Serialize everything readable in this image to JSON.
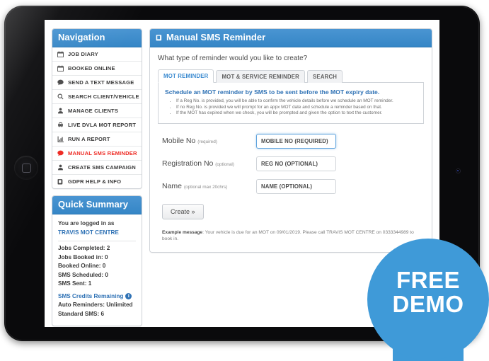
{
  "sidebar": {
    "nav_title": "Navigation",
    "nav_items": [
      {
        "label": "JOB DIARY",
        "icon": "calendar-icon",
        "active": false
      },
      {
        "label": "BOOKED ONLINE",
        "icon": "calendar-icon",
        "active": false
      },
      {
        "label": "SEND A TEXT MESSAGE",
        "icon": "comment-icon",
        "active": false
      },
      {
        "label": "SEARCH CLIENT/VEHICLE",
        "icon": "search-icon",
        "active": false
      },
      {
        "label": "MANAGE CLIENTS",
        "icon": "user-icon",
        "active": false
      },
      {
        "label": "LIVE DVLA MOT REPORT",
        "icon": "car-icon",
        "active": false
      },
      {
        "label": "RUN A REPORT",
        "icon": "chart-icon",
        "active": false
      },
      {
        "label": "MANUAL SMS REMINDER",
        "icon": "comment-icon",
        "active": true
      },
      {
        "label": "CREATE SMS CAMPAIGN",
        "icon": "user-icon",
        "active": false
      },
      {
        "label": "GDPR HELP & INFO",
        "icon": "book-icon",
        "active": false
      }
    ],
    "summary_title": "Quick Summary",
    "summary": {
      "logged_in_label": "You are logged in as",
      "company": "TRAVIS MOT CENTRE",
      "stats": [
        "Jobs Completed: 2",
        "Jobs Booked in: 0",
        "Booked Online: 0",
        "SMS Scheduled: 0",
        "SMS Sent: 1"
      ],
      "credits_label": "SMS Credits Remaining",
      "credits_info_glyph": "i",
      "auto_reminders": "Auto Reminders: Unlimited",
      "standard_sms": "Standard SMS: 6"
    }
  },
  "main": {
    "title": "Manual SMS Reminder",
    "title_icon": "book-icon",
    "question": "What type of reminder would you like to create?",
    "tabs": [
      {
        "label": "MOT REMINDER",
        "active": true
      },
      {
        "label": "MOT & SERVICE REMINDER",
        "active": false
      },
      {
        "label": "SEARCH",
        "active": false
      }
    ],
    "info": {
      "title": "Schedule an MOT reminder by SMS to be sent before the MOT expiry date.",
      "bullets": [
        "If a Reg No. is provided, you will be able to confirm the vehicle details before we schedule an MOT reminder.",
        "If no Reg No. is provided we will prompt for an appx MOT date and schedule a reminder based on that.",
        "If the MOT has expired when we check, you will be prompted and given the option to text the customer."
      ]
    },
    "form": {
      "fields": [
        {
          "label": "Mobile No",
          "hint": "(required)",
          "placeholder": "MOBILE NO (REQUIRED)",
          "value": "",
          "focused": true
        },
        {
          "label": "Registration No",
          "hint": "(optional)",
          "placeholder": "REG NO (OPTIONAL)",
          "value": "",
          "focused": false
        },
        {
          "label": "Name",
          "hint": "(optional max 20chrs)",
          "placeholder": "NAME (OPTIONAL)",
          "value": "",
          "focused": false
        }
      ],
      "create_label": "Create »"
    },
    "example_label": "Example message",
    "example_text": ": Your vehicle is due for an MOT on 09/01/2019. Please call TRAVIS MOT CENTRE on 0333344989 to book in."
  },
  "badge": {
    "line1": "FREE",
    "line2": "DEMO"
  },
  "colors": {
    "panel_header_blue": "#3c8dcc",
    "accent_blue": "#2f72b5",
    "active_red": "#ee2b24",
    "badge_blue": "#3f9ad8"
  }
}
